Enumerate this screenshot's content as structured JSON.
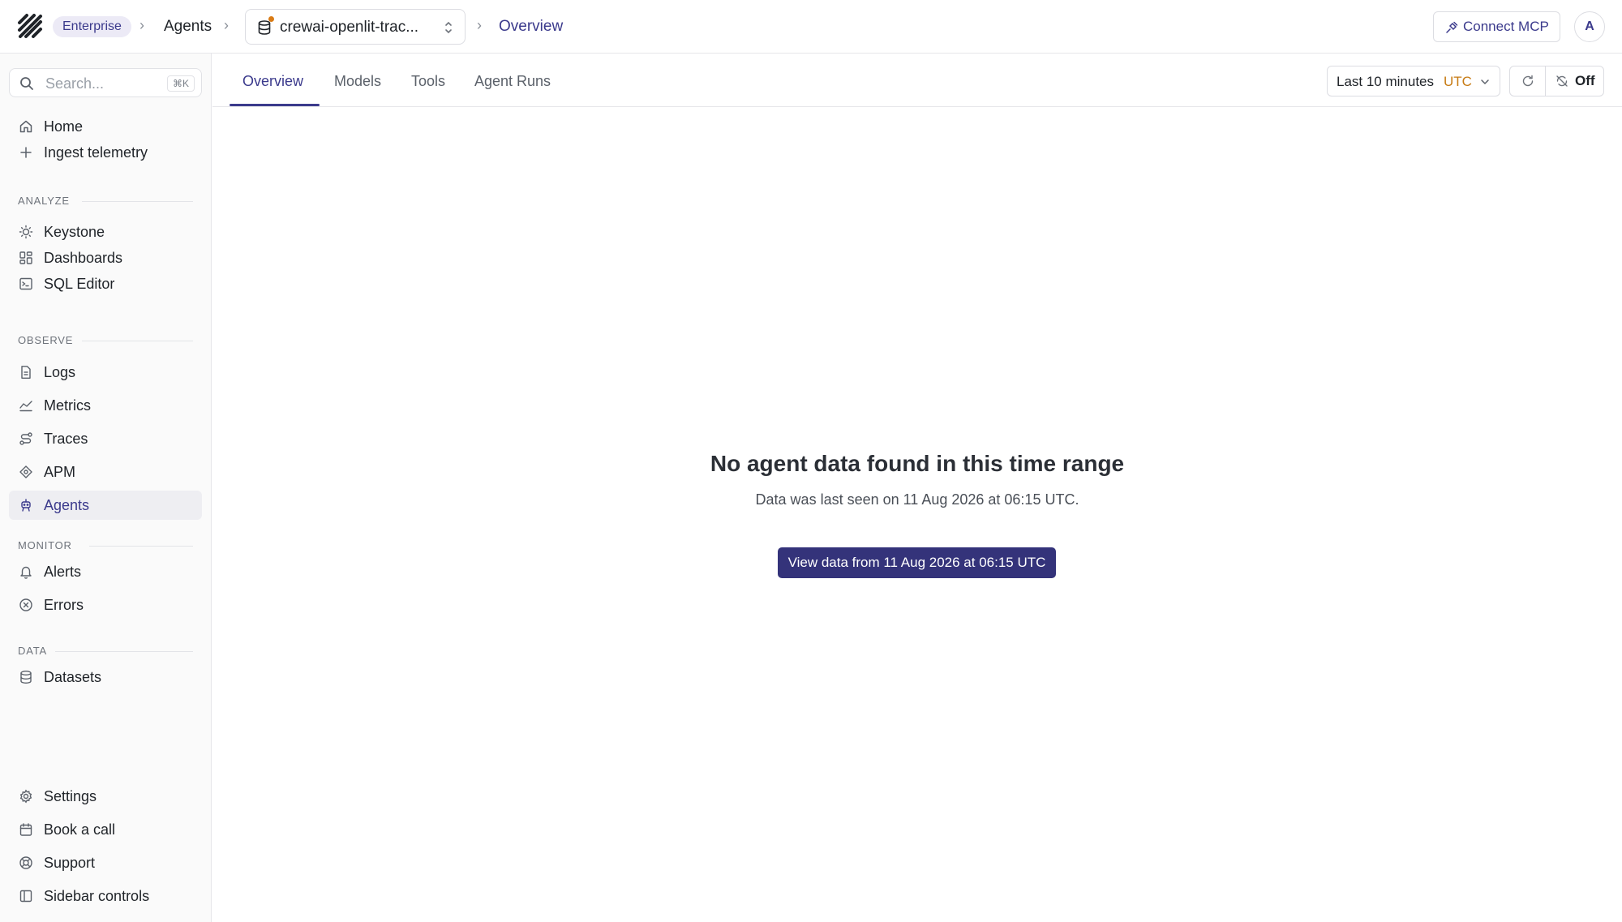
{
  "header": {
    "workspace_badge": "Enterprise",
    "breadcrumb_agents": "Agents",
    "project_name": "crewai-openlit-trac...",
    "breadcrumb_current": "Overview",
    "connect_mcp_label": "Connect MCP",
    "avatar_initial": "A"
  },
  "sidebar": {
    "search_placeholder": "Search...",
    "search_shortcut": "⌘K",
    "top_items": [
      {
        "label": "Home",
        "icon": "home-icon"
      },
      {
        "label": "Ingest telemetry",
        "icon": "plus-icon"
      }
    ],
    "sections": [
      {
        "label": "ANALYZE",
        "items": [
          {
            "label": "Keystone",
            "icon": "lightbulb-icon"
          },
          {
            "label": "Dashboards",
            "icon": "dashboard-icon"
          },
          {
            "label": "SQL Editor",
            "icon": "terminal-icon"
          }
        ]
      },
      {
        "label": "OBSERVE",
        "items": [
          {
            "label": "Logs",
            "icon": "file-icon"
          },
          {
            "label": "Metrics",
            "icon": "chart-line-icon"
          },
          {
            "label": "Traces",
            "icon": "route-icon"
          },
          {
            "label": "APM",
            "icon": "apm-icon"
          },
          {
            "label": "Agents",
            "icon": "bot-icon"
          }
        ]
      },
      {
        "label": "MONITOR",
        "items": [
          {
            "label": "Alerts",
            "icon": "bell-icon"
          },
          {
            "label": "Errors",
            "icon": "x-circle-icon"
          }
        ]
      },
      {
        "label": "DATA",
        "items": [
          {
            "label": "Datasets",
            "icon": "database-icon"
          }
        ]
      }
    ],
    "bottom_items": [
      {
        "label": "Settings",
        "icon": "gear-icon"
      },
      {
        "label": "Book a call",
        "icon": "calendar-icon"
      },
      {
        "label": "Support",
        "icon": "lifebuoy-icon"
      },
      {
        "label": "Sidebar controls",
        "icon": "sidebar-icon"
      }
    ],
    "active_item": "Agents"
  },
  "tabs": [
    "Overview",
    "Models",
    "Tools",
    "Agent Runs"
  ],
  "active_tab": "Overview",
  "toolbar": {
    "time_range_label": "Last 10 minutes",
    "timezone": "UTC",
    "autorefresh_label": "Off"
  },
  "empty_state": {
    "title": "No agent data found in this time range",
    "subtitle": "Data was last seen on 11 Aug 2026 at 06:15 UTC.",
    "button_label": "View data from 11 Aug 2026 at 06:15 UTC"
  },
  "colors": {
    "accent": "#3b3a8c",
    "button_bg": "#34337a",
    "timezone": "#c77b14",
    "status_dot": "#d97b15"
  }
}
